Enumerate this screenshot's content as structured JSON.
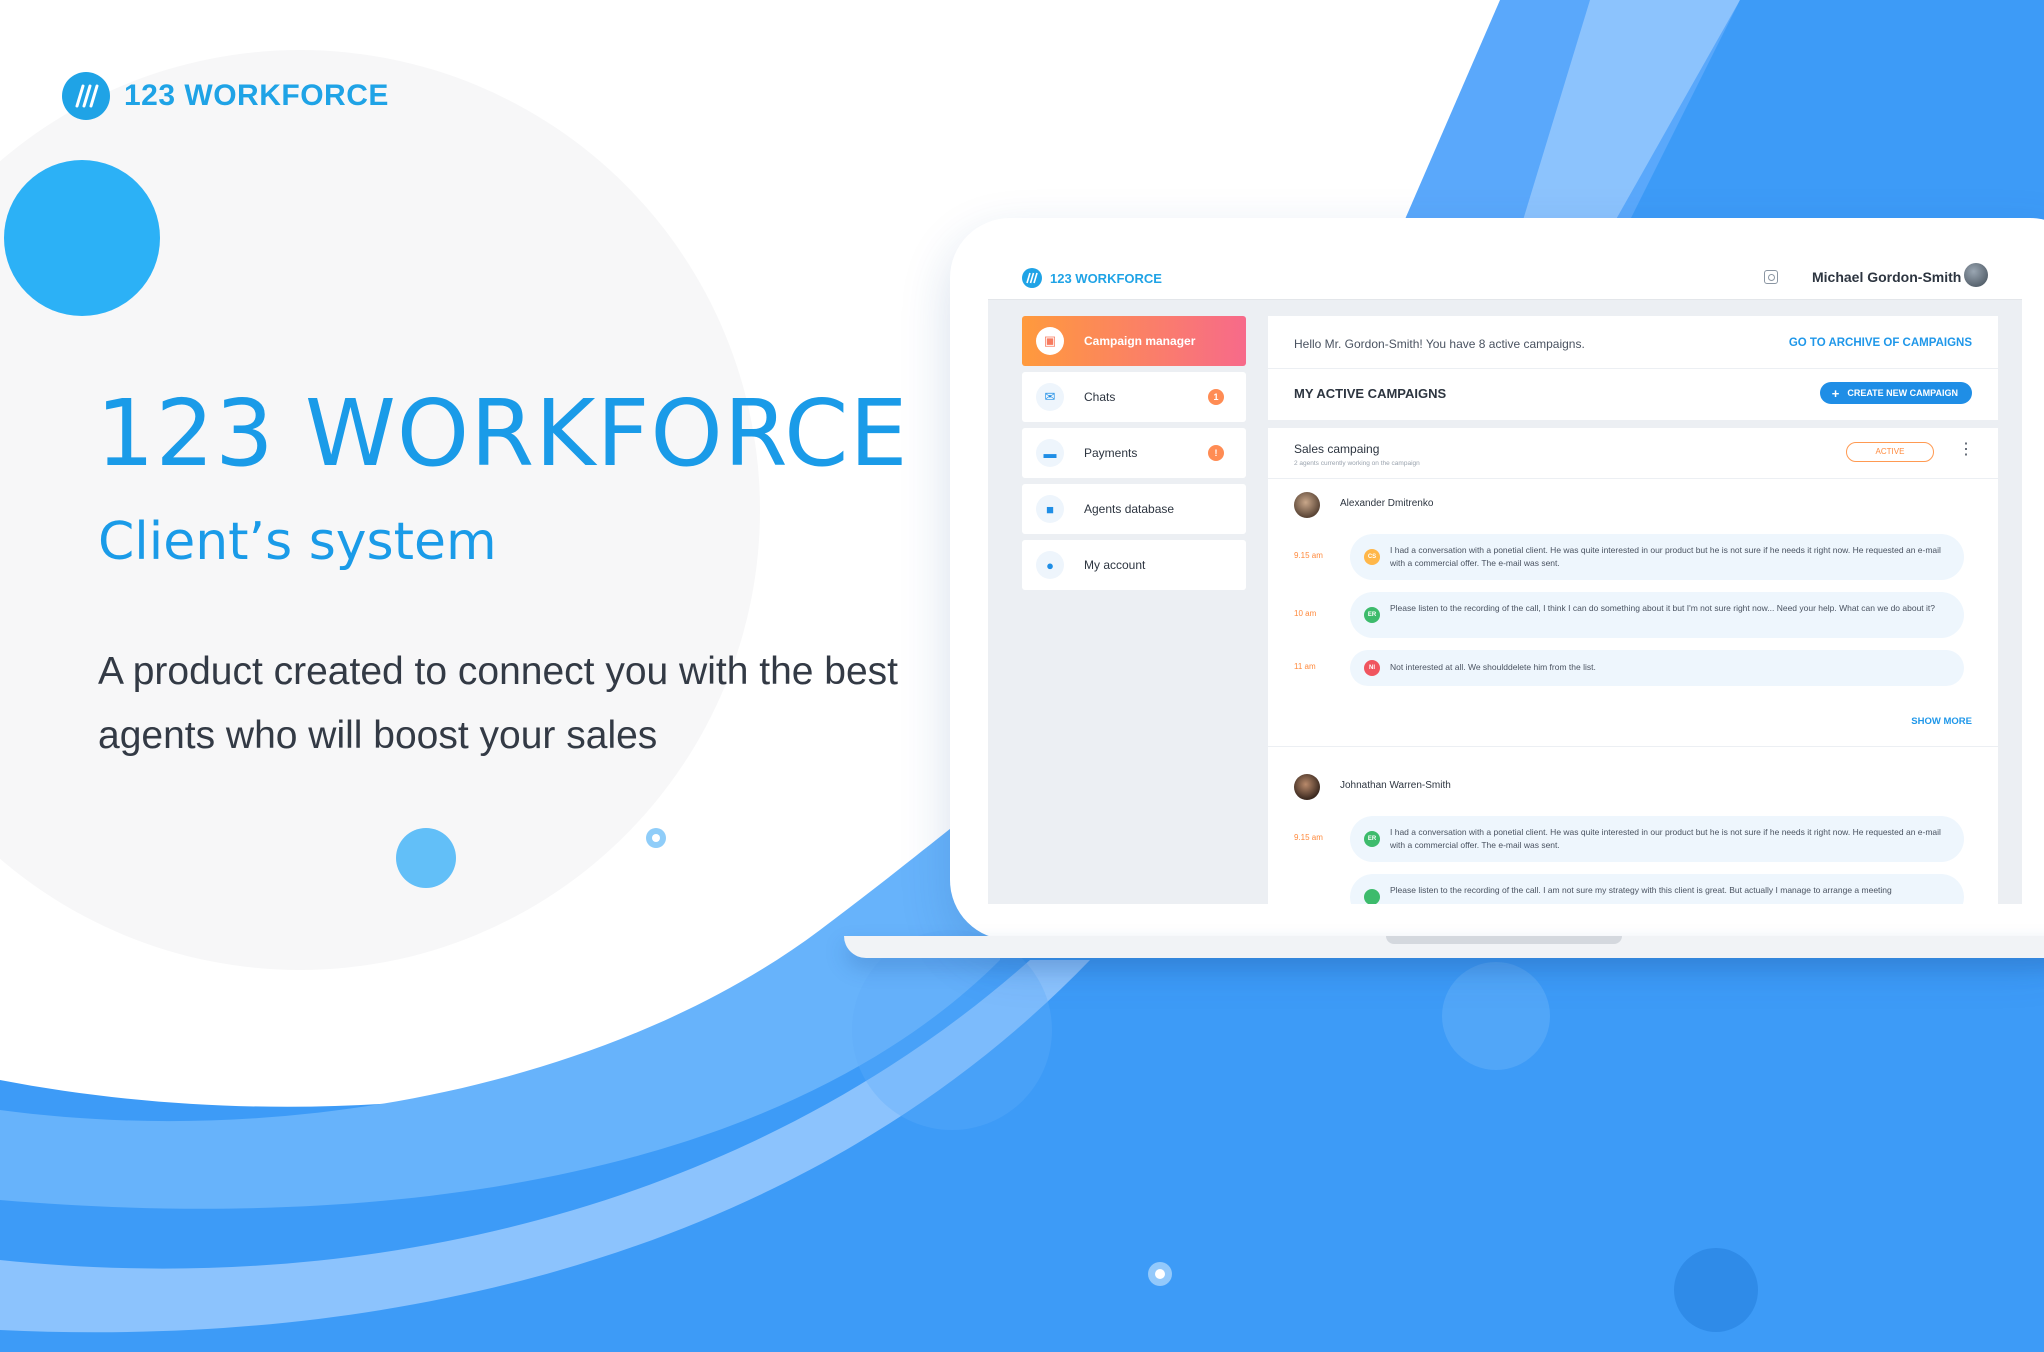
{
  "brand": {
    "name": "123 WORKFORCE"
  },
  "hero": {
    "title": "123 WORKFORCE",
    "subtitle": "Client’s system",
    "description": "A product created to connect you with the best agents who will boost your sales"
  },
  "colors": {
    "brand_blue": "#1fa3e6",
    "accent_orange": "#ff8a3d",
    "active_gradient_start": "#ff9a3c",
    "active_gradient_end": "#f76a8a",
    "background_blue": "#3d9bf7"
  },
  "app": {
    "topbar": {
      "brand": "123 WORKFORCE",
      "camera_icon": "camera-icon",
      "user_name": "Michael Gordon-Smith"
    },
    "sidebar": {
      "items": [
        {
          "label": "Campaign manager",
          "icon": "presentation-icon",
          "active": true,
          "badge": ""
        },
        {
          "label": "Chats",
          "icon": "chat-icon",
          "active": false,
          "badge": "1"
        },
        {
          "label": "Payments",
          "icon": "card-icon",
          "active": false,
          "badge": "!"
        },
        {
          "label": "Agents database",
          "icon": "briefcase-icon",
          "active": false,
          "badge": ""
        },
        {
          "label": "My account",
          "icon": "user-icon",
          "active": false,
          "badge": ""
        }
      ]
    },
    "main": {
      "greeting": "Hello Mr. Gordon-Smith!  You have 8 active campaigns.",
      "archive_link": "GO TO ARCHIVE OF CAMPAIGNS",
      "active_title": "MY ACTIVE CAMPAIGNS",
      "create_button": "CREATE NEW CAMPAIGN",
      "campaign": {
        "title": "Sales campaing",
        "subtitle": "2 agents currently working on the campaign",
        "status": "ACTIVE"
      },
      "agents": [
        {
          "name": "Alexander Dmitrenko",
          "messages": [
            {
              "time": "9.15 am",
              "initials": "CS",
              "color": "#ffb74a",
              "text": "I had a conversation with a ponetial  client. He was quite interested in our product but he is not sure if he needs it right now. He requested an e-mail with a commercial offer. The e-mail was sent."
            },
            {
              "time": "10 am",
              "initials": "ER",
              "color": "#3dbb6c",
              "text": "Please listen to the recording of the call, I think I can do something about it but I'm not sure right now... Need your help. What can we do about it?"
            },
            {
              "time": "11 am",
              "initials": "NI",
              "color": "#f0555f",
              "text": "Not interested at all. We shoulddelete him from the list."
            }
          ],
          "show_more": "SHOW MORE"
        },
        {
          "name": "Johnathan Warren-Smith",
          "messages": [
            {
              "time": "9.15 am",
              "initials": "ER",
              "color": "#3dbb6c",
              "text": "I had a conversation with a ponetial  client. He was quite interested in our product but he is not sure if he needs it right now. He requested an e-mail with a commercial offer. The e-mail was sent."
            },
            {
              "time": "",
              "initials": "",
              "color": "#3dbb6c",
              "text": "Please listen to the recording of the call. I am not sure my strategy with this client is great. But actually I manage to arrange a meeting"
            }
          ]
        }
      ]
    }
  }
}
